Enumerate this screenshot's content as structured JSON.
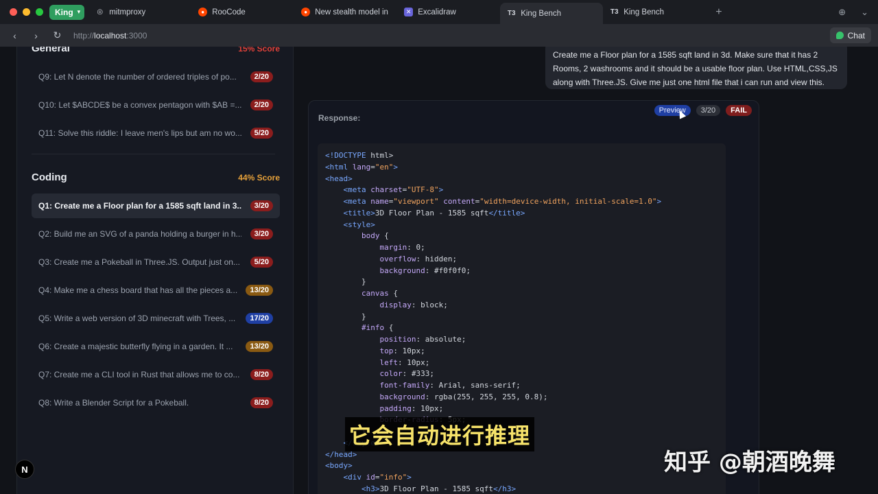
{
  "browser": {
    "profile": "King",
    "tabs": [
      {
        "title": "mitmproxy",
        "icon": "mitmproxy-icon"
      },
      {
        "title": "RooCode",
        "icon": "reddit-icon"
      },
      {
        "title": "New stealth model in r",
        "icon": "reddit-icon"
      },
      {
        "title": "Excalidraw",
        "icon": "excalidraw-icon"
      },
      {
        "title": "King Bench",
        "icon": "t3-icon",
        "active": true
      },
      {
        "title": "King Bench",
        "icon": "t3-icon"
      }
    ],
    "url_scheme": "http://",
    "url_host": "localhost",
    "url_port": ":3000",
    "chat_label": "Chat"
  },
  "sidebar": {
    "general": {
      "title": "General",
      "score": "15% Score"
    },
    "general_items": [
      {
        "text": "Q9: Let N denote the number of ordered triples of po...",
        "badge": "2/20"
      },
      {
        "text": "Q10: Let $ABCDE$ be a convex pentagon with $AB =...",
        "badge": "2/20"
      },
      {
        "text": "Q11: Solve this riddle: I leave men's lips but am no wo...",
        "badge": "5/20"
      }
    ],
    "coding": {
      "title": "Coding",
      "score": "44% Score"
    },
    "coding_items": [
      {
        "text": "Q1: Create me a Floor plan for a 1585 sqft land in 3...",
        "badge": "3/20",
        "active": true
      },
      {
        "text": "Q2: Build me an SVG of a panda holding a burger in h...",
        "badge": "3/20"
      },
      {
        "text": "Q3: Create me a Pokeball in Three.JS. Output just on...",
        "badge": "5/20"
      },
      {
        "text": "Q4: Make me a chess board that has all the pieces a...",
        "badge": "13/20"
      },
      {
        "text": "Q5: Write a web version of 3D minecraft with Trees, ...",
        "badge": "17/20"
      },
      {
        "text": "Q6: Create a majestic butterfly flying in a garden. It ...",
        "badge": "13/20"
      },
      {
        "text": "Q7: Create me a CLI tool in Rust that allows me to co...",
        "badge": "8/20"
      },
      {
        "text": "Q8: Write a Blender Script for a Pokeball.",
        "badge": "8/20"
      }
    ]
  },
  "main": {
    "prompt": "Create me a Floor plan for a 1585 sqft land in 3d. Make sure that it has 2 Rooms, 2 washrooms and it should be a usable floor plan. Use HTML,CSS,JS along with Three.JS. Give me just one html file that i can run and view this.",
    "response_label": "Response:",
    "preview_label": "Preview",
    "score": "3/20",
    "verdict": "FAIL"
  },
  "overlay": {
    "subtitle": "它会自动进行推理",
    "watermark": "知乎 @朝酒晚舞",
    "logo": "N"
  },
  "colors": {
    "accent_blue": "#1f3fa3",
    "fail_red": "#7f1d1d",
    "score_red": "#e1423a",
    "score_orange": "#e8a23a"
  }
}
